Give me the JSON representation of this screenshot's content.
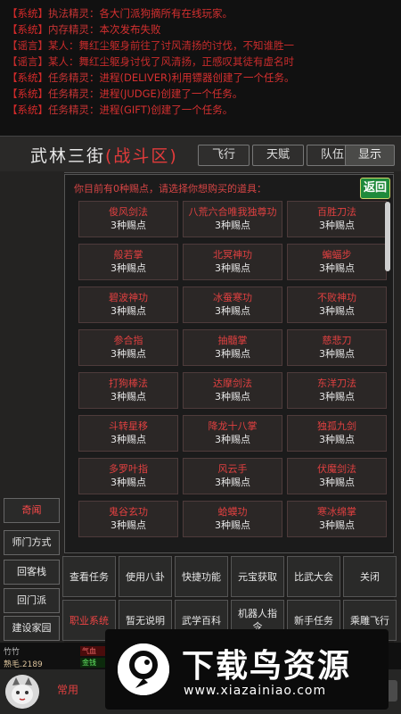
{
  "chat": [
    {
      "ch": "【系统】",
      "pref": "执法精灵：",
      "msg": "各大门派狗摘所有在线玩家。",
      "kind": "system"
    },
    {
      "ch": "【系统】",
      "pref": "内存精灵：",
      "msg": "本次发布失败",
      "kind": "system"
    },
    {
      "ch": "【谣言】",
      "pref": "某人：",
      "msg": "舞红尘躯身前往了讨风清扬的讨伐，不知谁胜一",
      "kind": "rumor"
    },
    {
      "ch": "【谣言】",
      "pref": "某人：",
      "msg": "舞红尘躯身讨伐了风清扬，正感叹其徒有虚名时",
      "kind": "rumor"
    },
    {
      "ch": "【系统】",
      "pref": "任务精灵：",
      "msg": "进程(DELIVER)利用镖器创建了一个任务。",
      "kind": "system"
    },
    {
      "ch": "【系统】",
      "pref": "任务精灵：",
      "msg": "进程(JUDGE)创建了一个任务。",
      "kind": "system"
    },
    {
      "ch": "【系统】",
      "pref": "任务精灵：",
      "msg": "进程(GIFT)创建了一个任务。",
      "kind": "system"
    }
  ],
  "header": {
    "title": "武林三街",
    "zone": "(战斗区)",
    "buttons": [
      "飞行",
      "天赋",
      "队伍",
      "显示"
    ]
  },
  "shop": {
    "note": "你目前有0种赐点，请选择你想购买的道具：",
    "back_label": "返回",
    "items": [
      {
        "name": "俊风剑法",
        "price": "3种赐点"
      },
      {
        "name": "八荒六合唯我独尊功",
        "price": "3种赐点"
      },
      {
        "name": "百胜刀法",
        "price": "3种赐点"
      },
      {
        "name": "般若掌",
        "price": "3种赐点"
      },
      {
        "name": "北冥神功",
        "price": "3种赐点"
      },
      {
        "name": "蝙蝠步",
        "price": "3种赐点"
      },
      {
        "name": "碧波神功",
        "price": "3种赐点"
      },
      {
        "name": "冰蚕寒功",
        "price": "3种赐点"
      },
      {
        "name": "不败神功",
        "price": "3种赐点"
      },
      {
        "name": "参合指",
        "price": "3种赐点"
      },
      {
        "name": "抽髓掌",
        "price": "3种赐点"
      },
      {
        "name": "慈悲刀",
        "price": "3种赐点"
      },
      {
        "name": "打狗棒法",
        "price": "3种赐点"
      },
      {
        "name": "达摩剑法",
        "price": "3种赐点"
      },
      {
        "name": "东洋刀法",
        "price": "3种赐点"
      },
      {
        "name": "斗转星移",
        "price": "3种赐点"
      },
      {
        "name": "降龙十八掌",
        "price": "3种赐点"
      },
      {
        "name": "独孤九剑",
        "price": "3种赐点"
      },
      {
        "name": "多罗叶指",
        "price": "3种赐点"
      },
      {
        "name": "风云手",
        "price": "3种赐点"
      },
      {
        "name": "伏魔剑法",
        "price": "3种赐点"
      },
      {
        "name": "鬼谷玄功",
        "price": "3种赐点"
      },
      {
        "name": "蛤蟆功",
        "price": "3种赐点"
      },
      {
        "name": "寒冰绵掌",
        "price": "3种赐点"
      }
    ]
  },
  "side_buttons": [
    {
      "label": "奇闻",
      "red": true
    },
    {
      "label": "师门方式",
      "red": false
    },
    {
      "label": "回客栈",
      "red": false
    },
    {
      "label": "回门派",
      "red": false
    },
    {
      "label": "建设家园",
      "red": false
    }
  ],
  "actions": [
    {
      "label": "查看任务",
      "red": false
    },
    {
      "label": "使用八卦",
      "red": false
    },
    {
      "label": "快捷功能",
      "red": false
    },
    {
      "label": "元宝获取",
      "red": false
    },
    {
      "label": "比武大会",
      "red": false
    },
    {
      "label": "关闭",
      "red": false
    },
    {
      "label": "职业系统",
      "red": true
    },
    {
      "label": "暂无说明",
      "red": false
    },
    {
      "label": "武学百科",
      "red": false
    },
    {
      "label": "机器人指令",
      "red": false
    },
    {
      "label": "新手任务",
      "red": false
    },
    {
      "label": "乘雕飞行",
      "red": false
    }
  ],
  "status": {
    "player": "竹竹",
    "fame": "熟毛.2189",
    "bar1": "气血",
    "bar2": "金钱"
  },
  "bottom": {
    "common": "常用"
  },
  "watermark": {
    "title": "下载鸟资源",
    "url": "www.xiazainiao.com"
  },
  "colors": {
    "accent_red": "#e04040",
    "panel": "#2b2726",
    "back_green": "#1f8a3b"
  }
}
